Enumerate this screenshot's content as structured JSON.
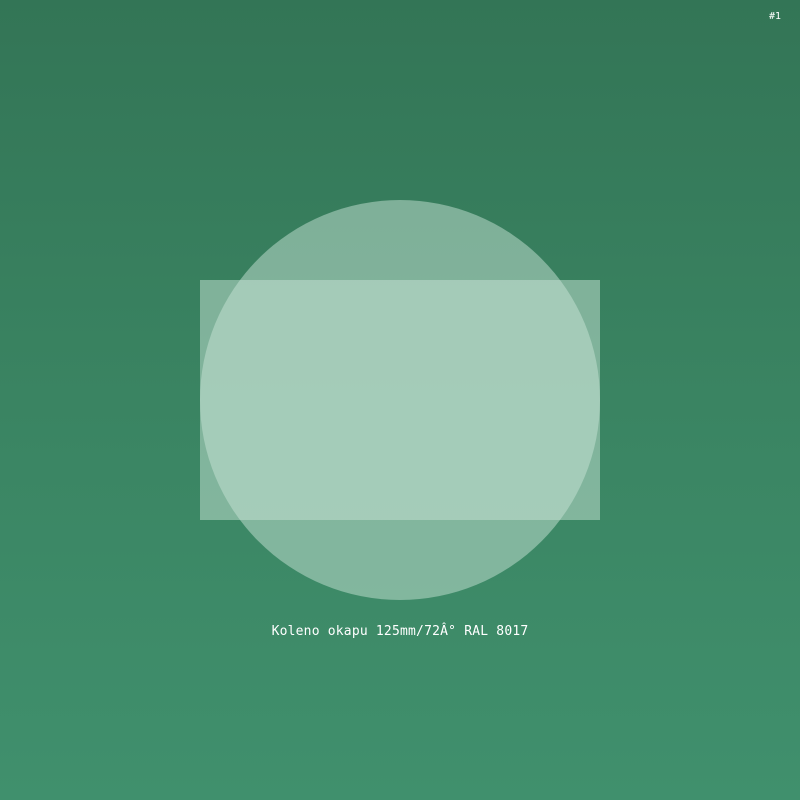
{
  "corner": {
    "label": "#1"
  },
  "caption": {
    "text": "Koleno okapu 125mm/72Â° RAL 8017"
  },
  "colors": {
    "background_top": "#337556",
    "background_bottom": "#40906d",
    "shape_fill": "#c8e3d6"
  }
}
